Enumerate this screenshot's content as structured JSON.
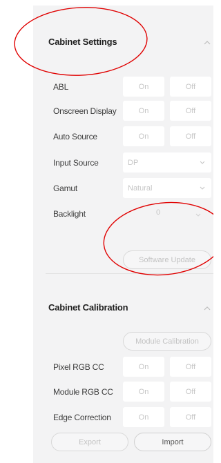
{
  "cabinet_settings": {
    "title": "Cabinet Settings",
    "rows": [
      {
        "label": "ABL",
        "on": "On",
        "off": "Off"
      },
      {
        "label": "Onscreen Display",
        "on": "On",
        "off": "Off"
      },
      {
        "label": "Auto Source",
        "on": "On",
        "off": "Off"
      }
    ],
    "input_source": {
      "label": "Input Source",
      "value": "DP"
    },
    "gamut": {
      "label": "Gamut",
      "value": "Natural"
    },
    "backlight": {
      "label": "Backlight",
      "value": "0"
    },
    "software_update_label": "Software Update"
  },
  "cabinet_calibration": {
    "title": "Cabinet Calibration",
    "module_calibration_label": "Module Calibration",
    "rows": [
      {
        "label": "Pixel RGB CC",
        "on": "On",
        "off": "Off"
      },
      {
        "label": "Module RGB CC",
        "on": "On",
        "off": "Off"
      },
      {
        "label": "Edge Correction",
        "on": "On",
        "off": "Off"
      }
    ],
    "export_label": "Export",
    "import_label": "Import"
  },
  "icons": {
    "collapse": "chevron-up-icon",
    "dropdown": "chevron-down-icon"
  },
  "colors": {
    "panel_bg": "#f3f3f4",
    "annotation_red": "#e00000"
  }
}
